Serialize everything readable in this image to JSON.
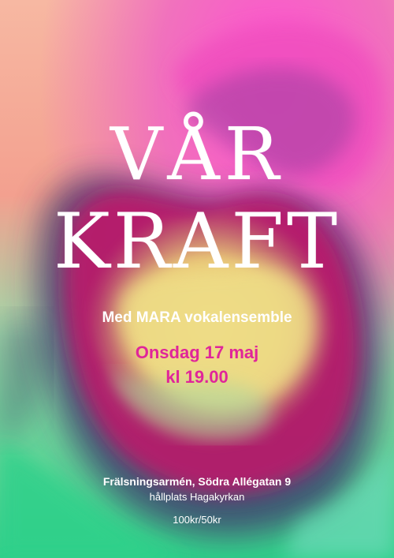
{
  "poster": {
    "title_line1": "VÅR",
    "title_line2": "KRAFT",
    "subtitle": "Med MARA vokalensemble",
    "date": "Onsdag 17 maj",
    "time": "kl 19.00",
    "venue": "Frälsningsarmén, Södra Allégatan 9",
    "stop": "hållplats Hagakyrkan",
    "price": "100kr/50kr"
  },
  "colors": {
    "accent_pink": "#e0259a",
    "text_white": "#ffffff"
  }
}
